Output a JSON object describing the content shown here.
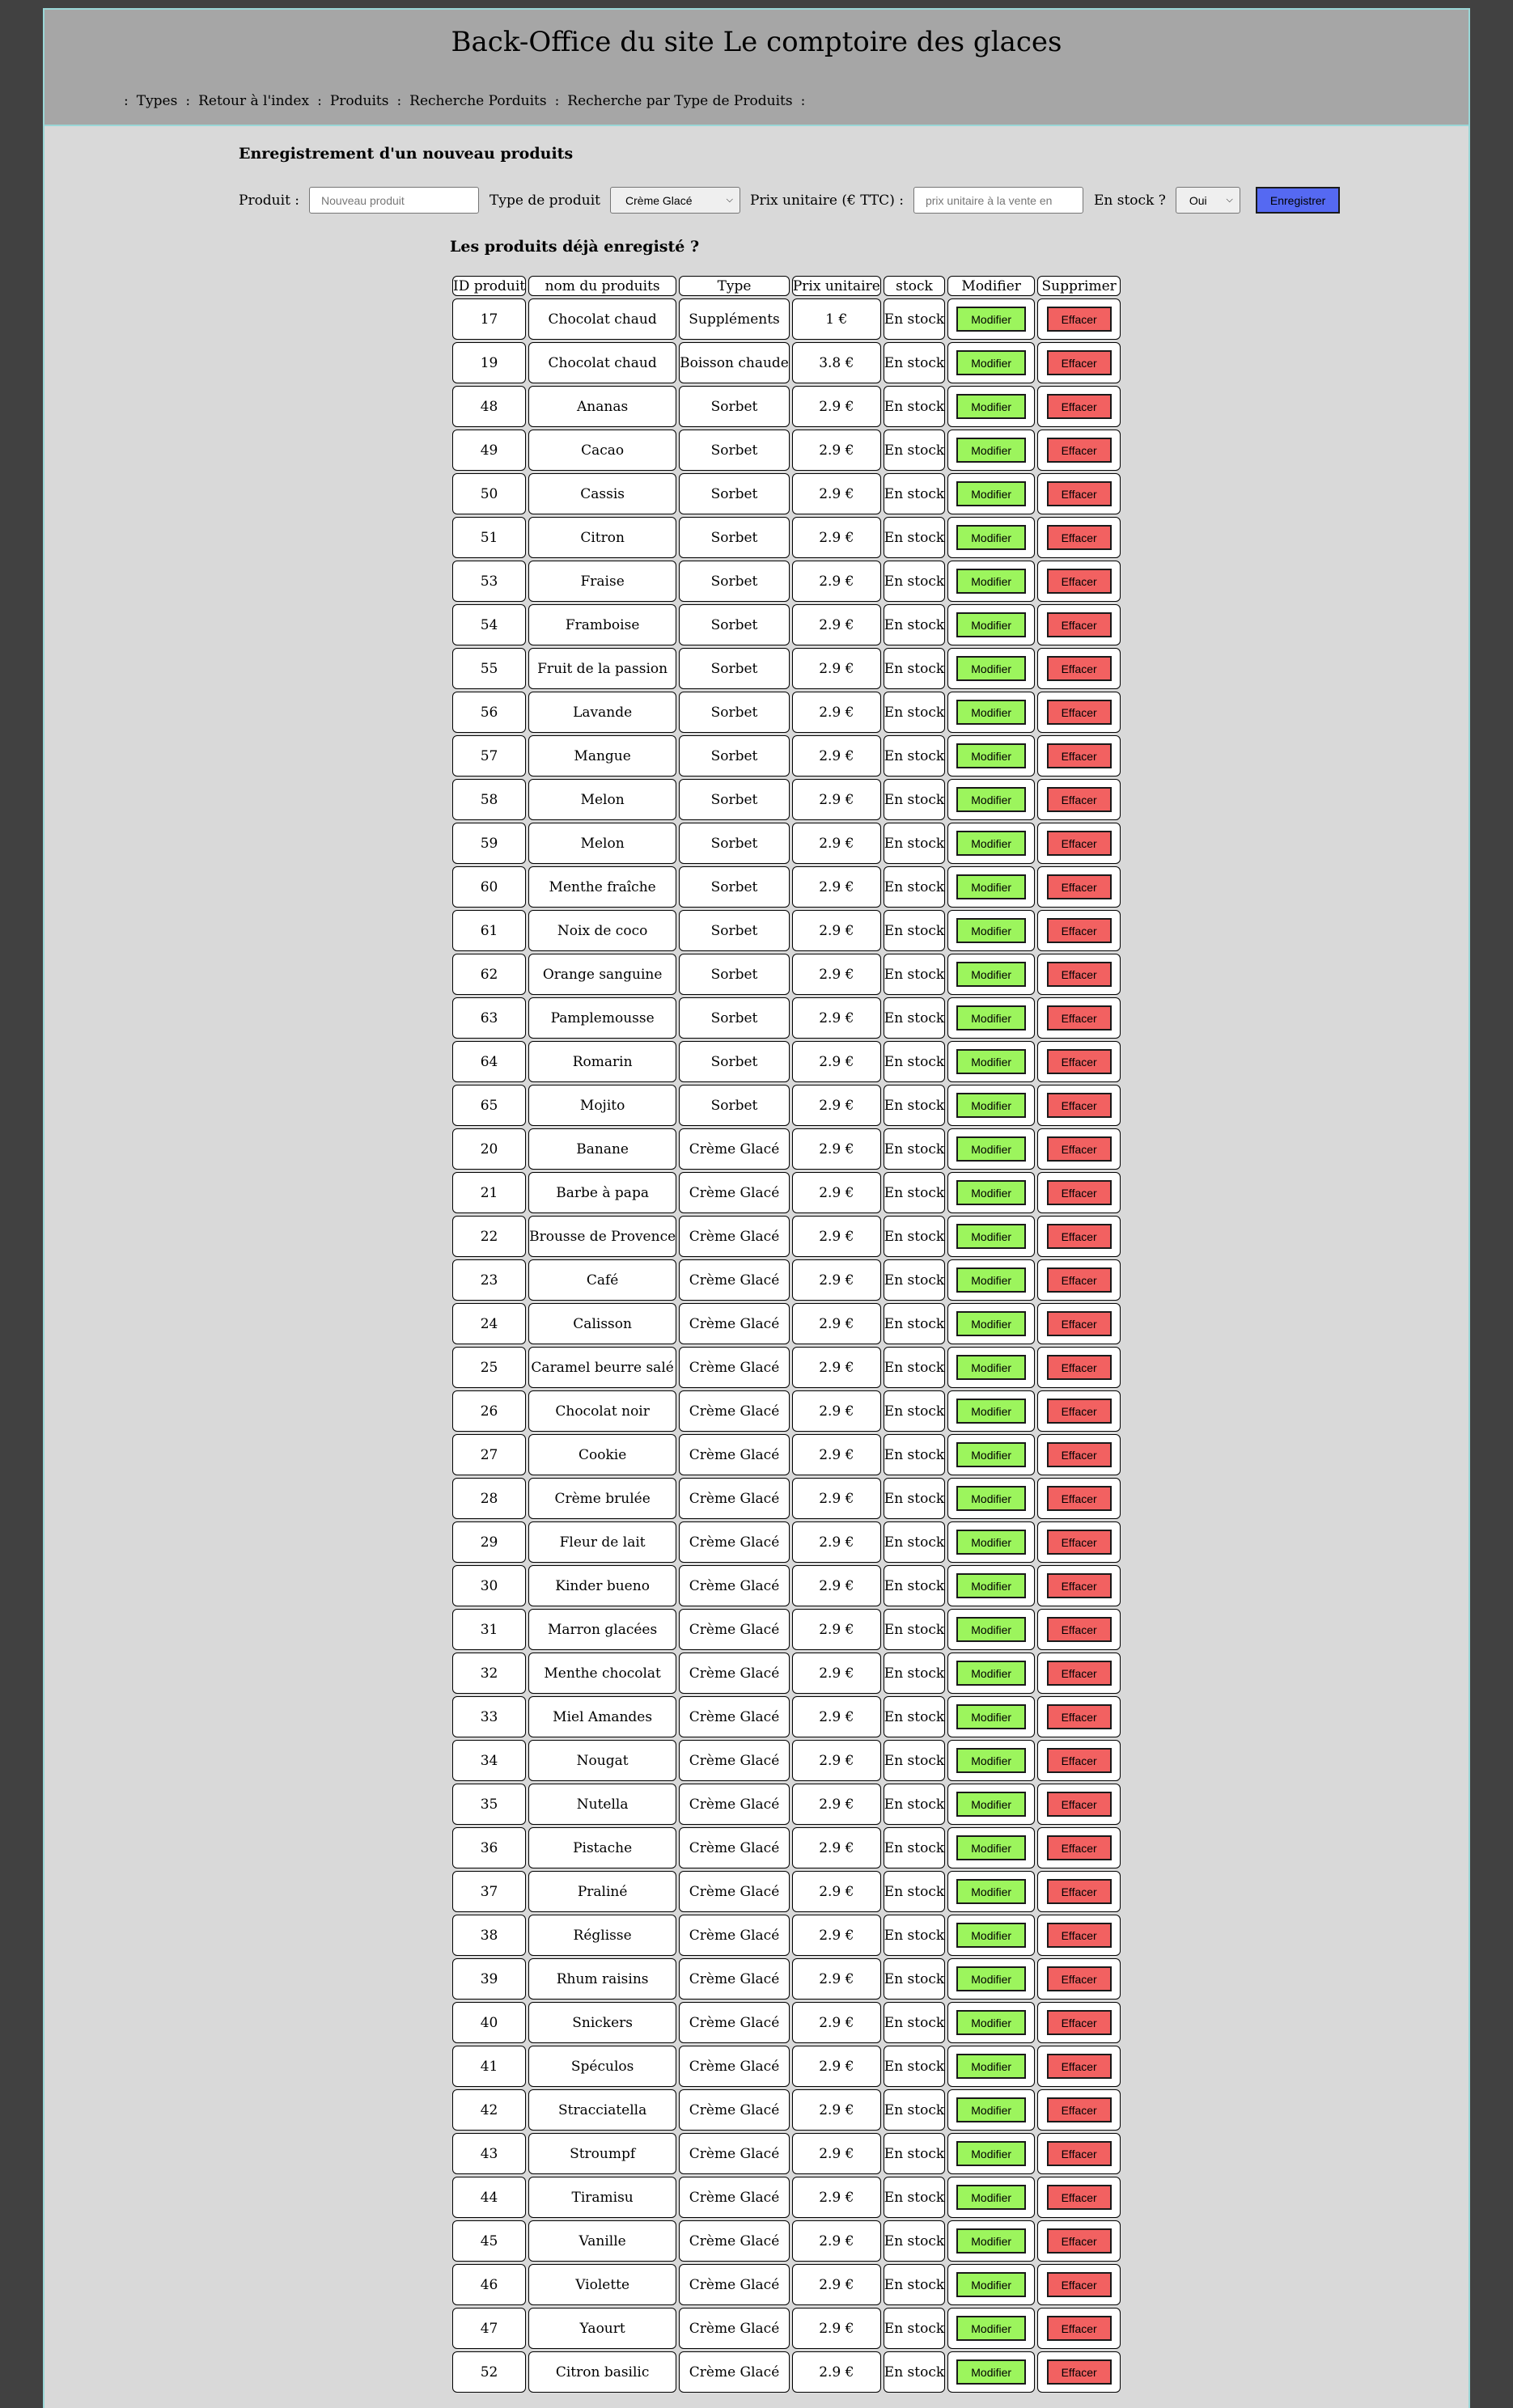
{
  "header": {
    "title": "Back-Office du site Le comptoire des glaces",
    "nav": [
      {
        "label": "Types"
      },
      {
        "label": "Retour à l'index"
      },
      {
        "label": "Produits"
      },
      {
        "label": "Recherche Porduits"
      },
      {
        "label": "Recherche par Type de Produits"
      }
    ],
    "separator": ":"
  },
  "form": {
    "title": "Enregistrement d'un nouveau produits",
    "produit_label": "Produit :",
    "produit_placeholder": "Nouveau produit",
    "type_label": "Type de produit",
    "type_selected": "Crème Glacé",
    "prix_label": "Prix unitaire (€ TTC) :",
    "prix_placeholder": "prix unitaire à la vente en",
    "stock_label": "En stock ?",
    "stock_selected": "Oui",
    "save_label": "Enregistrer"
  },
  "list": {
    "title": "Les produits déjà enregisté ?",
    "columns": [
      "ID produit",
      "nom du produits",
      "Type",
      "Prix unitaire",
      "stock",
      "Modifier",
      "Supprimer"
    ],
    "modify_label": "Modifier",
    "delete_label": "Effacer",
    "rows": [
      {
        "id": "17",
        "nom": "Chocolat chaud",
        "type": "Suppléments",
        "prix": "1 €",
        "stock": "En stock"
      },
      {
        "id": "19",
        "nom": "Chocolat chaud",
        "type": "Boisson chaude",
        "prix": "3.8 €",
        "stock": "En stock"
      },
      {
        "id": "48",
        "nom": "Ananas",
        "type": "Sorbet",
        "prix": "2.9 €",
        "stock": "En stock"
      },
      {
        "id": "49",
        "nom": "Cacao",
        "type": "Sorbet",
        "prix": "2.9 €",
        "stock": "En stock"
      },
      {
        "id": "50",
        "nom": "Cassis",
        "type": "Sorbet",
        "prix": "2.9 €",
        "stock": "En stock"
      },
      {
        "id": "51",
        "nom": "Citron",
        "type": "Sorbet",
        "prix": "2.9 €",
        "stock": "En stock"
      },
      {
        "id": "53",
        "nom": "Fraise",
        "type": "Sorbet",
        "prix": "2.9 €",
        "stock": "En stock"
      },
      {
        "id": "54",
        "nom": "Framboise",
        "type": "Sorbet",
        "prix": "2.9 €",
        "stock": "En stock"
      },
      {
        "id": "55",
        "nom": "Fruit de la passion",
        "type": "Sorbet",
        "prix": "2.9 €",
        "stock": "En stock"
      },
      {
        "id": "56",
        "nom": "Lavande",
        "type": "Sorbet",
        "prix": "2.9 €",
        "stock": "En stock"
      },
      {
        "id": "57",
        "nom": "Mangue",
        "type": "Sorbet",
        "prix": "2.9 €",
        "stock": "En stock"
      },
      {
        "id": "58",
        "nom": "Melon",
        "type": "Sorbet",
        "prix": "2.9 €",
        "stock": "En stock"
      },
      {
        "id": "59",
        "nom": "Melon",
        "type": "Sorbet",
        "prix": "2.9 €",
        "stock": "En stock"
      },
      {
        "id": "60",
        "nom": "Menthe fraîche",
        "type": "Sorbet",
        "prix": "2.9 €",
        "stock": "En stock"
      },
      {
        "id": "61",
        "nom": "Noix de coco",
        "type": "Sorbet",
        "prix": "2.9 €",
        "stock": "En stock"
      },
      {
        "id": "62",
        "nom": "Orange sanguine",
        "type": "Sorbet",
        "prix": "2.9 €",
        "stock": "En stock"
      },
      {
        "id": "63",
        "nom": "Pamplemousse",
        "type": "Sorbet",
        "prix": "2.9 €",
        "stock": "En stock"
      },
      {
        "id": "64",
        "nom": "Romarin",
        "type": "Sorbet",
        "prix": "2.9 €",
        "stock": "En stock"
      },
      {
        "id": "65",
        "nom": "Mojito",
        "type": "Sorbet",
        "prix": "2.9 €",
        "stock": "En stock"
      },
      {
        "id": "20",
        "nom": "Banane",
        "type": "Crème Glacé",
        "prix": "2.9 €",
        "stock": "En stock"
      },
      {
        "id": "21",
        "nom": "Barbe à papa",
        "type": "Crème Glacé",
        "prix": "2.9 €",
        "stock": "En stock"
      },
      {
        "id": "22",
        "nom": "Brousse de Provence",
        "type": "Crème Glacé",
        "prix": "2.9 €",
        "stock": "En stock"
      },
      {
        "id": "23",
        "nom": "Café",
        "type": "Crème Glacé",
        "prix": "2.9 €",
        "stock": "En stock"
      },
      {
        "id": "24",
        "nom": "Calisson",
        "type": "Crème Glacé",
        "prix": "2.9 €",
        "stock": "En stock"
      },
      {
        "id": "25",
        "nom": "Caramel beurre salé",
        "type": "Crème Glacé",
        "prix": "2.9 €",
        "stock": "En stock"
      },
      {
        "id": "26",
        "nom": "Chocolat noir",
        "type": "Crème Glacé",
        "prix": "2.9 €",
        "stock": "En stock"
      },
      {
        "id": "27",
        "nom": "Cookie",
        "type": "Crème Glacé",
        "prix": "2.9 €",
        "stock": "En stock"
      },
      {
        "id": "28",
        "nom": "Crème brulée",
        "type": "Crème Glacé",
        "prix": "2.9 €",
        "stock": "En stock"
      },
      {
        "id": "29",
        "nom": "Fleur de lait",
        "type": "Crème Glacé",
        "prix": "2.9 €",
        "stock": "En stock"
      },
      {
        "id": "30",
        "nom": "Kinder bueno",
        "type": "Crème Glacé",
        "prix": "2.9 €",
        "stock": "En stock"
      },
      {
        "id": "31",
        "nom": "Marron glacées",
        "type": "Crème Glacé",
        "prix": "2.9 €",
        "stock": "En stock"
      },
      {
        "id": "32",
        "nom": "Menthe chocolat",
        "type": "Crème Glacé",
        "prix": "2.9 €",
        "stock": "En stock"
      },
      {
        "id": "33",
        "nom": "Miel Amandes",
        "type": "Crème Glacé",
        "prix": "2.9 €",
        "stock": "En stock"
      },
      {
        "id": "34",
        "nom": "Nougat",
        "type": "Crème Glacé",
        "prix": "2.9 €",
        "stock": "En stock"
      },
      {
        "id": "35",
        "nom": "Nutella",
        "type": "Crème Glacé",
        "prix": "2.9 €",
        "stock": "En stock"
      },
      {
        "id": "36",
        "nom": "Pistache",
        "type": "Crème Glacé",
        "prix": "2.9 €",
        "stock": "En stock"
      },
      {
        "id": "37",
        "nom": "Praliné",
        "type": "Crème Glacé",
        "prix": "2.9 €",
        "stock": "En stock"
      },
      {
        "id": "38",
        "nom": "Réglisse",
        "type": "Crème Glacé",
        "prix": "2.9 €",
        "stock": "En stock"
      },
      {
        "id": "39",
        "nom": "Rhum raisins",
        "type": "Crème Glacé",
        "prix": "2.9 €",
        "stock": "En stock"
      },
      {
        "id": "40",
        "nom": "Snickers",
        "type": "Crème Glacé",
        "prix": "2.9 €",
        "stock": "En stock"
      },
      {
        "id": "41",
        "nom": "Spéculos",
        "type": "Crème Glacé",
        "prix": "2.9 €",
        "stock": "En stock"
      },
      {
        "id": "42",
        "nom": "Stracciatella",
        "type": "Crème Glacé",
        "prix": "2.9 €",
        "stock": "En stock"
      },
      {
        "id": "43",
        "nom": "Stroumpf",
        "type": "Crème Glacé",
        "prix": "2.9 €",
        "stock": "En stock"
      },
      {
        "id": "44",
        "nom": "Tiramisu",
        "type": "Crème Glacé",
        "prix": "2.9 €",
        "stock": "En stock"
      },
      {
        "id": "45",
        "nom": "Vanille",
        "type": "Crème Glacé",
        "prix": "2.9 €",
        "stock": "En stock"
      },
      {
        "id": "46",
        "nom": "Violette",
        "type": "Crème Glacé",
        "prix": "2.9 €",
        "stock": "En stock"
      },
      {
        "id": "47",
        "nom": "Yaourt",
        "type": "Crème Glacé",
        "prix": "2.9 €",
        "stock": "En stock"
      },
      {
        "id": "52",
        "nom": "Citron basilic",
        "type": "Crème Glacé",
        "prix": "2.9 €",
        "stock": "En stock"
      }
    ]
  },
  "colors": {
    "background": "#414141",
    "page": "#d9d9d9",
    "header": "#a6a6a6",
    "border_accent": "#9ad7d7",
    "save_button": "#5569f2",
    "modify_button": "#9cf55d",
    "delete_button": "#f26161"
  },
  "icons": {
    "select_arrow": "chevron-down-icon"
  }
}
